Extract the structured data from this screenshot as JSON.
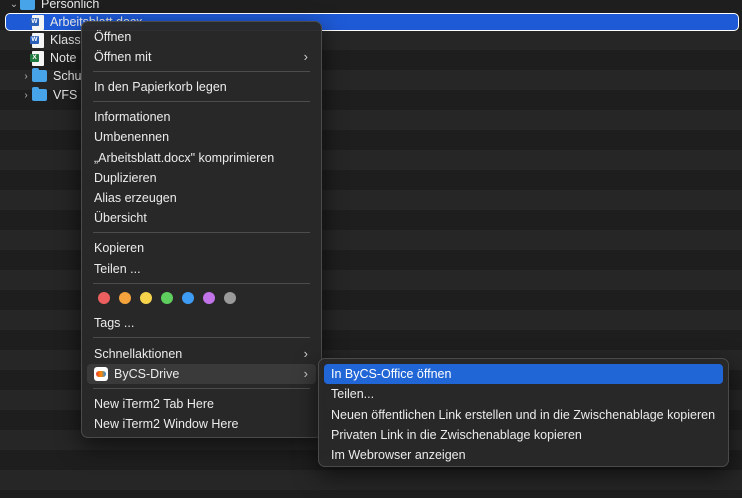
{
  "finder": {
    "root_folder": "Persönlich",
    "items": [
      {
        "name": "Arbeitsblatt.docx",
        "type": "word"
      },
      {
        "name": "Klass",
        "type": "word"
      },
      {
        "name": "Note",
        "type": "excel"
      },
      {
        "name": "Schu",
        "type": "folder"
      },
      {
        "name": "VFS",
        "type": "folder"
      }
    ]
  },
  "context_menu": {
    "open": "Öffnen",
    "open_with": "Öffnen mit",
    "move_to_trash": "In den Papierkorb legen",
    "get_info": "Informationen",
    "rename": "Umbenennen",
    "compress": "„Arbeitsblatt.docx\" komprimieren",
    "duplicate": "Duplizieren",
    "make_alias": "Alias erzeugen",
    "quick_look": "Übersicht",
    "copy": "Kopieren",
    "share": "Teilen ...",
    "tags": "Tags ...",
    "quick_actions": "Schnellaktionen",
    "bycs_drive": "ByCS-Drive",
    "iterm_tab": "New iTerm2 Tab Here",
    "iterm_window": "New iTerm2 Window Here",
    "tag_colors": [
      "#ec5f5f",
      "#f5a33d",
      "#f6d34a",
      "#5ecf5e",
      "#3f9cf5",
      "#c173e8",
      "#9a9a9a"
    ]
  },
  "submenu": {
    "open_in_office": "In ByCS-Office öffnen",
    "share": "Teilen...",
    "public_link": "Neuen öffentlichen Link erstellen und in die Zwischenablage kopieren",
    "private_link": "Privaten Link in die Zwischenablage kopieren",
    "show_in_browser": "Im Webrowser anzeigen"
  }
}
